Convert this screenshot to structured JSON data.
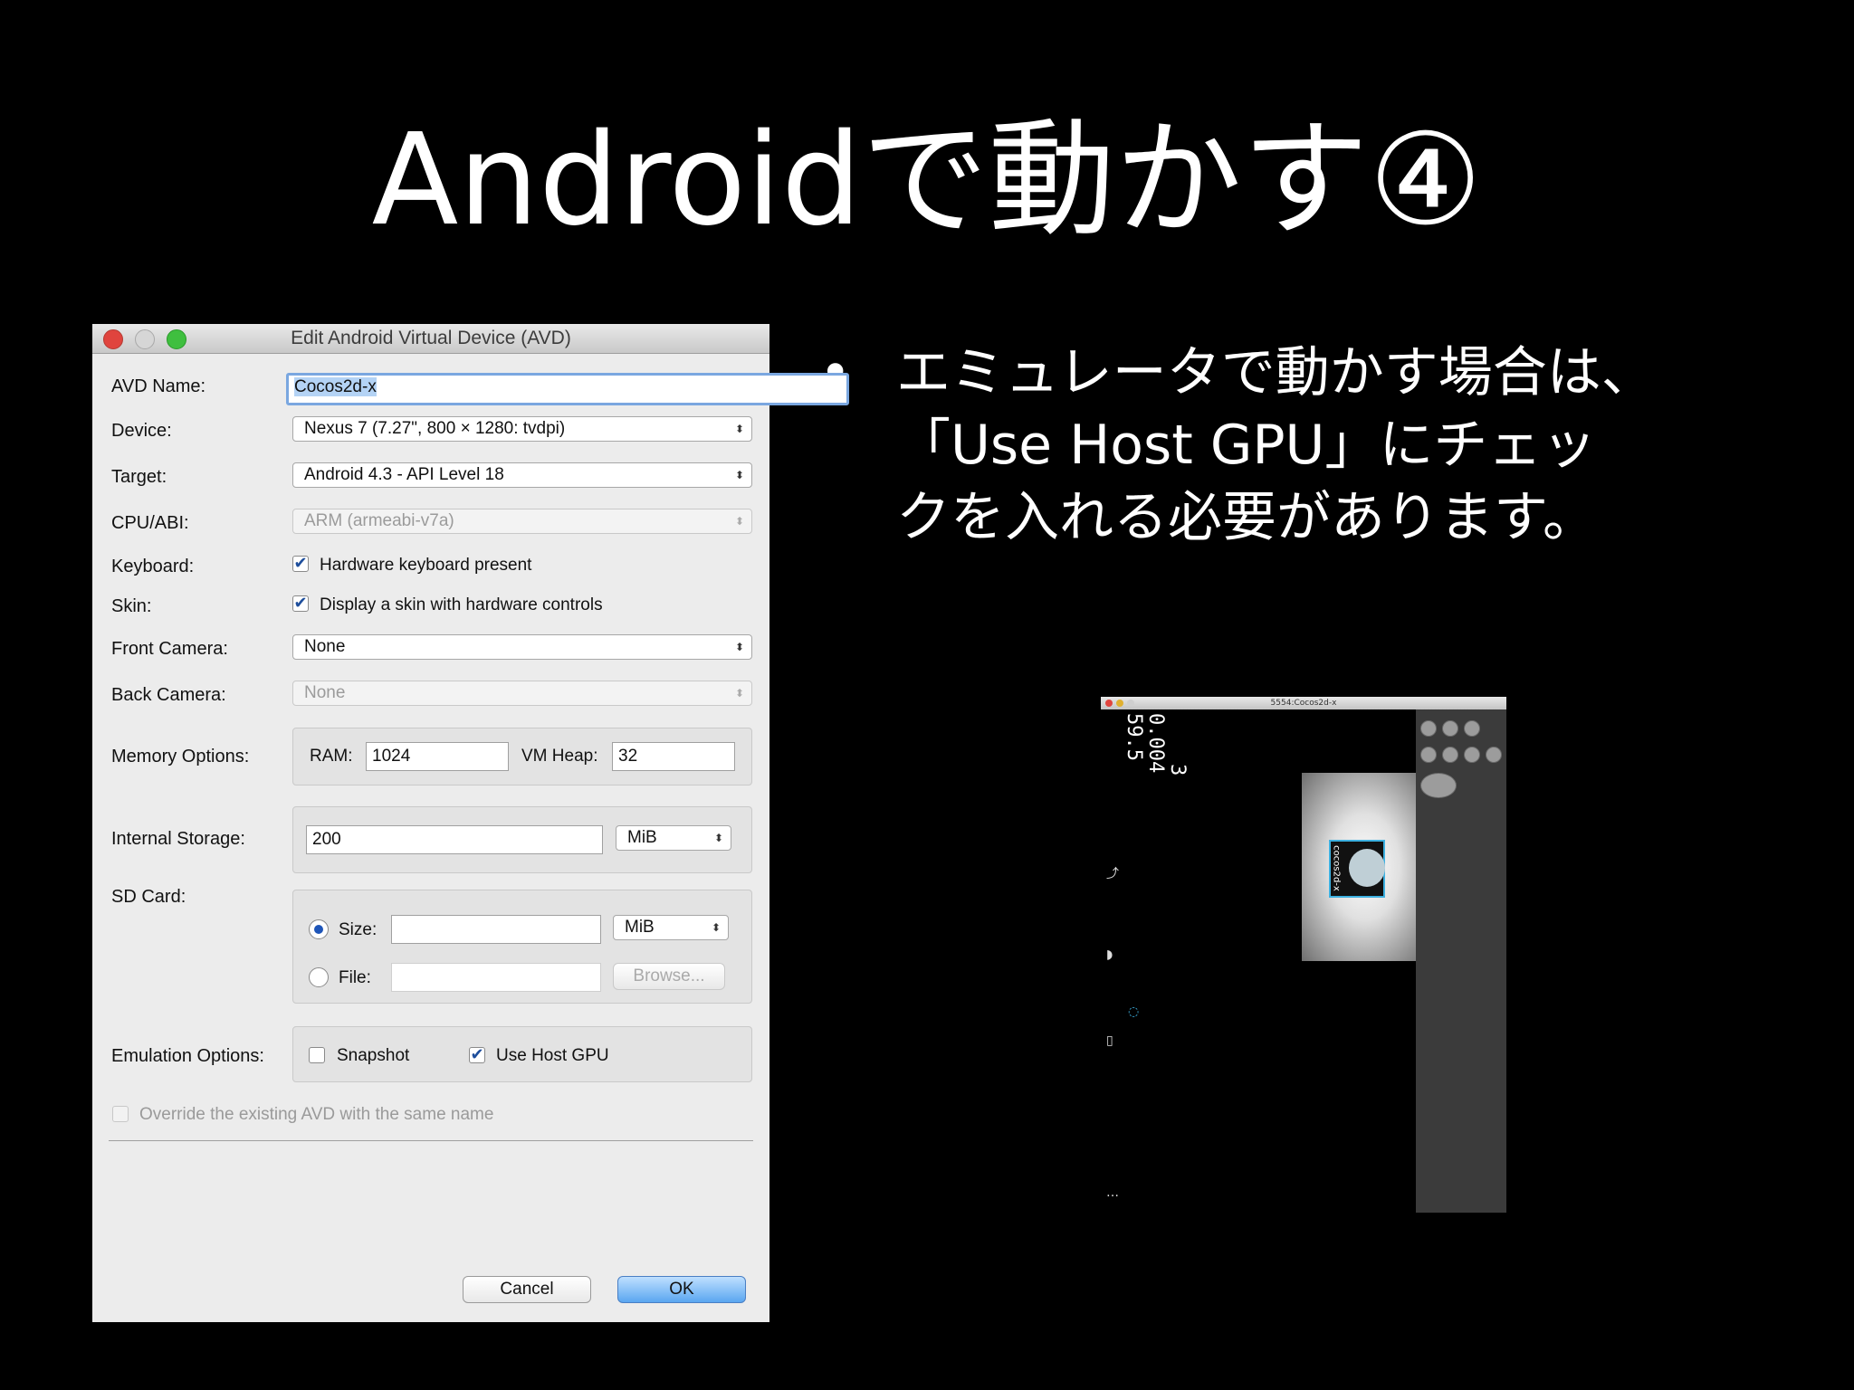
{
  "slide": {
    "title": "Androidで動かす④",
    "bullet_marker": "•",
    "bullet_lines": [
      "エミュレータで動かす場合は、",
      "「Use Host GPU」にチェッ",
      "クを入れる必要があります。"
    ]
  },
  "dialog": {
    "title": "Edit Android Virtual Device (AVD)",
    "labels": {
      "avd_name": "AVD Name:",
      "device": "Device:",
      "target": "Target:",
      "cpu_abi": "CPU/ABI:",
      "keyboard": "Keyboard:",
      "skin": "Skin:",
      "front_camera": "Front Camera:",
      "back_camera": "Back Camera:",
      "memory_options": "Memory Options:",
      "internal_storage": "Internal Storage:",
      "sd_card": "SD Card:",
      "emulation_options": "Emulation Options:"
    },
    "avd_name_value": "Cocos2d-x",
    "device_value": "Nexus 7 (7.27\", 800 × 1280: tvdpi)",
    "target_value": "Android 4.3 - API Level 18",
    "cpu_abi_value": "ARM (armeabi-v7a)",
    "keyboard_checkbox": {
      "label": "Hardware keyboard present",
      "checked": true
    },
    "skin_checkbox": {
      "label": "Display a skin with hardware controls",
      "checked": true
    },
    "front_camera_value": "None",
    "back_camera_value": "None",
    "memory": {
      "ram_label": "RAM:",
      "ram_value": "1024",
      "vm_heap_label": "VM Heap:",
      "vm_heap_value": "32"
    },
    "internal_storage": {
      "value": "200",
      "unit": "MiB"
    },
    "sd_card": {
      "size_label": "Size:",
      "size_value": "",
      "size_unit": "MiB",
      "size_selected": true,
      "file_label": "File:",
      "file_value": "",
      "browse_label": "Browse..."
    },
    "emulation": {
      "snapshot_label": "Snapshot",
      "snapshot_checked": false,
      "host_gpu_label": "Use Host GPU",
      "host_gpu_checked": true
    },
    "override_label": "Override the existing AVD with the same name",
    "cancel_label": "Cancel",
    "ok_label": "OK",
    "checkmark": "✔",
    "select_arrow": "⬍"
  },
  "emulator": {
    "window_title": "5554:Cocos2d-x",
    "fps_line1": "0.004",
    "fps_line2": "59.5",
    "fps_line3": "3",
    "logo_text": "cocos2d-x"
  }
}
